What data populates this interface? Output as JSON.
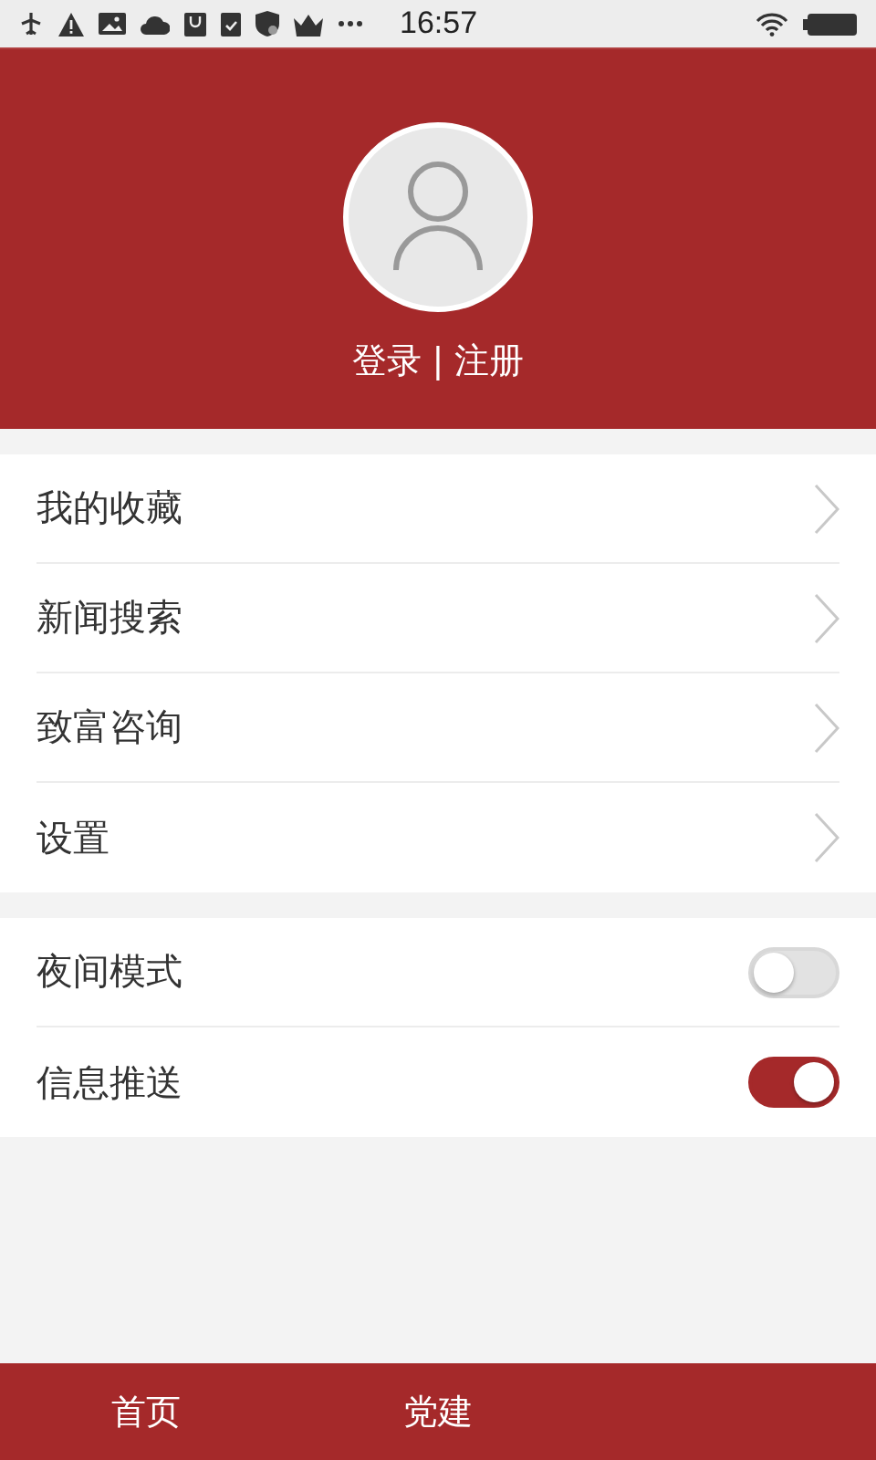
{
  "status_bar": {
    "time": "16:57"
  },
  "profile": {
    "login_text": "登录 | 注册"
  },
  "menu_groups": [
    {
      "items": [
        {
          "kind": "link",
          "label": "我的收藏"
        },
        {
          "kind": "link",
          "label": "新闻搜索"
        },
        {
          "kind": "link",
          "label": "致富咨询"
        },
        {
          "kind": "link",
          "label": "设置"
        }
      ]
    },
    {
      "items": [
        {
          "kind": "toggle",
          "label": "夜间模式",
          "on": false
        },
        {
          "kind": "toggle",
          "label": "信息推送",
          "on": true
        }
      ]
    }
  ],
  "tab_bar": {
    "tabs": [
      {
        "label": "首页"
      },
      {
        "label": "党建"
      }
    ]
  }
}
